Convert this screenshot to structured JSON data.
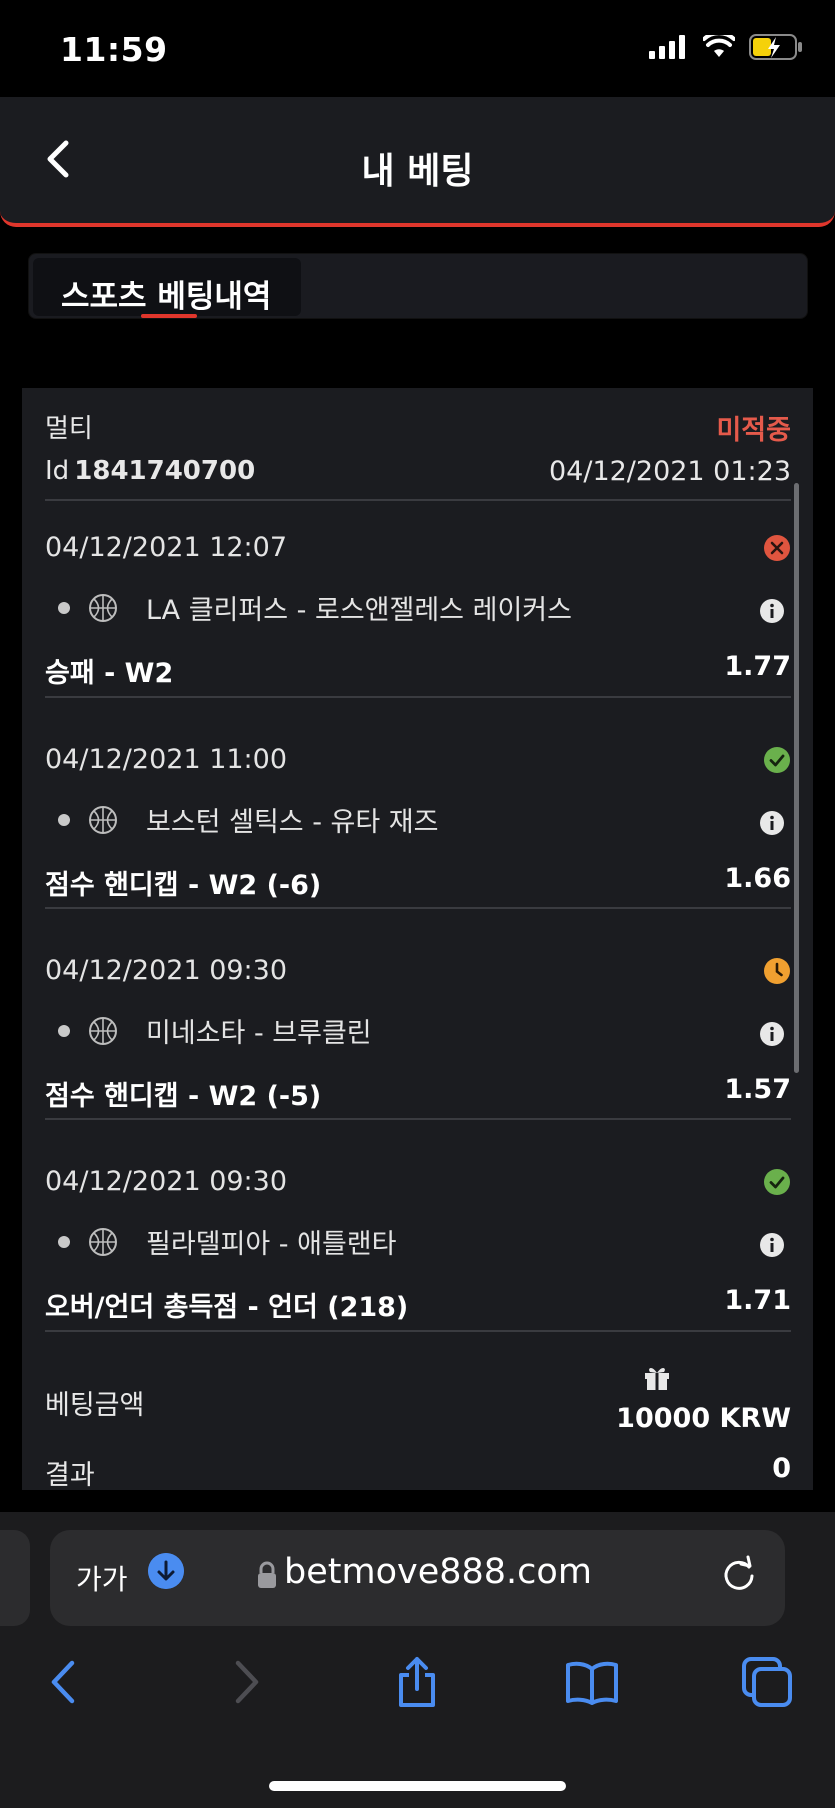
{
  "status_bar": {
    "time": "11:59"
  },
  "header": {
    "title": "내 베팅"
  },
  "tabs": [
    {
      "label": "스포츠 베팅내역"
    }
  ],
  "bet": {
    "type_label": "멀티",
    "status": "미적중",
    "id_prefix": "Id",
    "id_value": "1841740700",
    "placed_at": "04/12/2021 01:23",
    "legs": [
      {
        "date": "04/12/2021 12:07",
        "status": "lost",
        "match": "LA 클리퍼스 - 로스앤젤레스 레이커스",
        "market": "승패 - W2",
        "odds": "1.77"
      },
      {
        "date": "04/12/2021 11:00",
        "status": "won",
        "match": "보스턴 셀틱스 - 유타 재즈",
        "market": "점수 핸디캡 - W2 (-6)",
        "odds": "1.66"
      },
      {
        "date": "04/12/2021 09:30",
        "status": "pending",
        "match": "미네소타 - 브루클린",
        "market": "점수 핸디캡 - W2 (-5)",
        "odds": "1.57"
      },
      {
        "date": "04/12/2021 09:30",
        "status": "won",
        "match": "필라델피아 - 애틀랜타",
        "market": "오버/언더 총득점 - 언더 (218)",
        "odds": "1.71"
      }
    ],
    "stake_label": "베팅금액",
    "stake_value": "10000 KRW",
    "result_label": "결과",
    "result_value": "0"
  },
  "browser": {
    "text_size_label": "가가",
    "url": "betmove888.com"
  },
  "colors": {
    "accent": "#e0362c",
    "won": "#6ab04c",
    "lost": "#e0553f",
    "pending": "#f0a030",
    "link": "#4a8cf0"
  },
  "icons": [
    "back-chevron-icon",
    "basketball-icon",
    "info-icon",
    "gift-icon",
    "lock-icon",
    "reload-icon",
    "share-icon",
    "bookmarks-icon",
    "tabs-icon"
  ]
}
